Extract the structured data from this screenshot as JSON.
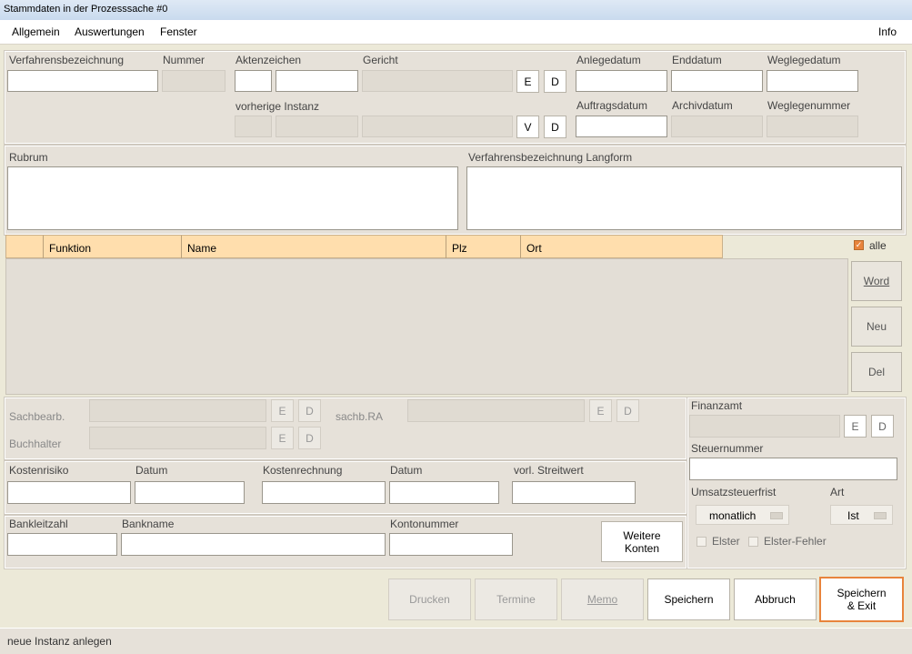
{
  "window": {
    "title": "Stammdaten in der Prozesssache #0"
  },
  "menu": {
    "items": [
      "Allgemein",
      "Auswertungen",
      "Fenster"
    ],
    "info": "Info"
  },
  "top": {
    "verfahrensbezeichnung": "Verfahrensbezeichnung",
    "nummer": "Nummer",
    "aktenzeichen": "Aktenzeichen",
    "gericht": "Gericht",
    "vorherige_instanz": "vorherige Instanz",
    "anlegedatum": "Anlegedatum",
    "enddatum": "Enddatum",
    "weglegedatum": "Weglegedatum",
    "auftragsdatum": "Auftragsdatum",
    "archivdatum": "Archivdatum",
    "weglegenummer": "Weglegenummer",
    "btn_e": "E",
    "btn_d": "D",
    "btn_v": "V"
  },
  "rubrum": {
    "label": "Rubrum",
    "langform_label": "Verfahrensbezeichnung Langform"
  },
  "table": {
    "columns": [
      "",
      "Funktion",
      "Name",
      "Plz",
      "Ort"
    ],
    "alle": "alle",
    "alle_checked": true
  },
  "side_buttons": {
    "word": "Word",
    "neu": "Neu",
    "del": "Del"
  },
  "sach": {
    "sachbearb": "Sachbearb.",
    "buchhalter": "Buchhalter",
    "sachb_ra": "sachb.RA",
    "e": "E",
    "d": "D"
  },
  "kosten": {
    "kostenrisiko": "Kostenrisiko",
    "datum1": "Datum",
    "kostenrechnung": "Kostenrechnung",
    "datum2": "Datum",
    "streitwert": "vorl. Streitwert"
  },
  "bank": {
    "bankleitzahl": "Bankleitzahl",
    "bankname": "Bankname",
    "kontonummer": "Kontonummer",
    "weitere": "Weitere",
    "konten": "Konten"
  },
  "finanz": {
    "finanzamt": "Finanzamt",
    "e": "E",
    "d": "D",
    "steuernummer": "Steuernummer",
    "umsatzsteuerfrist": "Umsatzsteuerfrist",
    "art": "Art",
    "frist_value": "monatlich",
    "art_value": "Ist",
    "elster": "Elster",
    "elster_fehler": "Elster-Fehler"
  },
  "bottom": {
    "drucken": "Drucken",
    "termine": "Termine",
    "memo": "Memo",
    "speichern": "Speichern",
    "abbruch": "Abbruch",
    "speichern_exit_1": "Speichern",
    "speichern_exit_2": "& Exit"
  },
  "status": {
    "text": "neue Instanz anlegen"
  },
  "colors": {
    "header_bg": "#ffdead",
    "focus_border": "#e8843c"
  }
}
